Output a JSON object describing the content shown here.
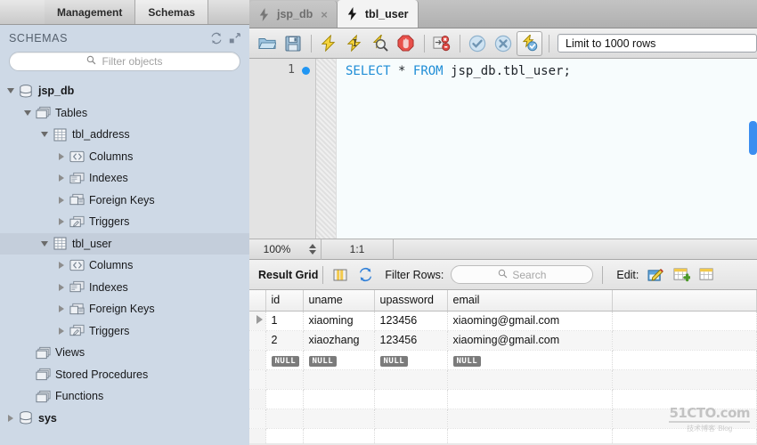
{
  "left_panel": {
    "tabs": [
      {
        "label": "Management",
        "active": false
      },
      {
        "label": "Schemas",
        "active": true
      }
    ],
    "section_title": "SCHEMAS",
    "refresh_icon": "refresh-icon",
    "collapse_icon": "collapse-icon",
    "filter": {
      "placeholder": "Filter objects",
      "value": "",
      "icon": "search-icon"
    },
    "tree": [
      {
        "label": "jsp_db",
        "indent": 0,
        "twisty": "down",
        "icon": "schema-icon",
        "bold": true,
        "selected": false
      },
      {
        "label": "Tables",
        "indent": 1,
        "twisty": "down",
        "icon": "folder-icon",
        "bold": false,
        "selected": false
      },
      {
        "label": "tbl_address",
        "indent": 2,
        "twisty": "down",
        "icon": "table-icon",
        "bold": false,
        "selected": false
      },
      {
        "label": "Columns",
        "indent": 3,
        "twisty": "right",
        "icon": "columns-icon",
        "bold": false,
        "selected": false
      },
      {
        "label": "Indexes",
        "indent": 3,
        "twisty": "right",
        "icon": "indexes-icon",
        "bold": false,
        "selected": false
      },
      {
        "label": "Foreign Keys",
        "indent": 3,
        "twisty": "right",
        "icon": "foreign-keys-icon",
        "bold": false,
        "selected": false
      },
      {
        "label": "Triggers",
        "indent": 3,
        "twisty": "right",
        "icon": "triggers-icon",
        "bold": false,
        "selected": false
      },
      {
        "label": "tbl_user",
        "indent": 2,
        "twisty": "down",
        "icon": "table-icon",
        "bold": false,
        "selected": true
      },
      {
        "label": "Columns",
        "indent": 3,
        "twisty": "right",
        "icon": "columns-icon",
        "bold": false,
        "selected": false
      },
      {
        "label": "Indexes",
        "indent": 3,
        "twisty": "right",
        "icon": "indexes-icon",
        "bold": false,
        "selected": false
      },
      {
        "label": "Foreign Keys",
        "indent": 3,
        "twisty": "right",
        "icon": "foreign-keys-icon",
        "bold": false,
        "selected": false
      },
      {
        "label": "Triggers",
        "indent": 3,
        "twisty": "right",
        "icon": "triggers-icon",
        "bold": false,
        "selected": false
      },
      {
        "label": "Views",
        "indent": 1,
        "twisty": "none",
        "icon": "folder-icon",
        "bold": false,
        "selected": false
      },
      {
        "label": "Stored Procedures",
        "indent": 1,
        "twisty": "none",
        "icon": "folder-icon",
        "bold": false,
        "selected": false
      },
      {
        "label": "Functions",
        "indent": 1,
        "twisty": "none",
        "icon": "folder-icon",
        "bold": false,
        "selected": false
      },
      {
        "label": "sys",
        "indent": 0,
        "twisty": "right",
        "icon": "schema-icon",
        "bold": true,
        "selected": false
      }
    ]
  },
  "editor": {
    "tabs": [
      {
        "label": "jsp_db",
        "icon": "lightning-icon",
        "active": false,
        "closable": true,
        "close_glyph": "×"
      },
      {
        "label": "tbl_user",
        "icon": "lightning-icon",
        "active": true,
        "closable": false,
        "close_glyph": ""
      }
    ],
    "toolbar": [
      {
        "name": "open-sql-file-button",
        "title": "Open SQL Script"
      },
      {
        "name": "save-sql-file-button",
        "title": "Save SQL Script"
      },
      {
        "name": "execute-statement-button",
        "title": "Execute"
      },
      {
        "name": "execute-current-statement-button",
        "title": "Execute Current Statement"
      },
      {
        "name": "explain-statement-button",
        "title": "Explain"
      },
      {
        "name": "stop-execution-button",
        "title": "Stop"
      },
      {
        "name": "toggle-stop-on-error-button",
        "title": "Stop On Error"
      },
      {
        "name": "commit-button",
        "title": "Commit"
      },
      {
        "name": "rollback-button",
        "title": "Rollback"
      },
      {
        "name": "toggle-autocommit-button",
        "title": "Auto-Commit"
      }
    ],
    "limit_select": {
      "value": "Limit to 1000 rows"
    },
    "line_number": "1",
    "breakpoint_marker": "execution-dot",
    "sql_tokens": [
      {
        "t": "SELECT",
        "k": true
      },
      {
        "t": " ",
        "k": false
      },
      {
        "t": "*",
        "k": false
      },
      {
        "t": " ",
        "k": false
      },
      {
        "t": "FROM",
        "k": true
      },
      {
        "t": " jsp_db.tbl_user;",
        "k": false
      }
    ],
    "status": {
      "zoom": "100%",
      "position": "1:1"
    }
  },
  "result_panel": {
    "title": "Result Grid",
    "grid_view_icon": "grid-view-icon",
    "refresh_icon": "refresh-icon",
    "filter_rows_label": "Filter Rows:",
    "search": {
      "placeholder": "Search",
      "value": "",
      "icon": "search-icon"
    },
    "edit_label": "Edit:",
    "edit_buttons": [
      {
        "name": "edit-row-button"
      },
      {
        "name": "insert-row-button"
      },
      {
        "name": "delete-row-button"
      }
    ],
    "columns": [
      "id",
      "uname",
      "upassword",
      "email"
    ],
    "rows": [
      {
        "marker": true,
        "cells": [
          "1",
          "xiaoming",
          "123456",
          "xiaoming@gmail.com"
        ]
      },
      {
        "marker": false,
        "cells": [
          "2",
          "xiaozhang",
          "123456",
          "xiaoming@gmail.com"
        ]
      }
    ],
    "placeholder_row": [
      "NULL",
      "NULL",
      "NULL",
      "NULL"
    ],
    "empty_rows": 4
  },
  "watermark": {
    "line1": "51CTO.com",
    "line2": "技术博客",
    "line2_sup": "Blog"
  },
  "colors": {
    "sidebar_bg": "#ced9e6",
    "sql_keyword": "#1f8dd6",
    "accent_blue": "#2196f3",
    "null_badge": "#7b7b7b"
  }
}
